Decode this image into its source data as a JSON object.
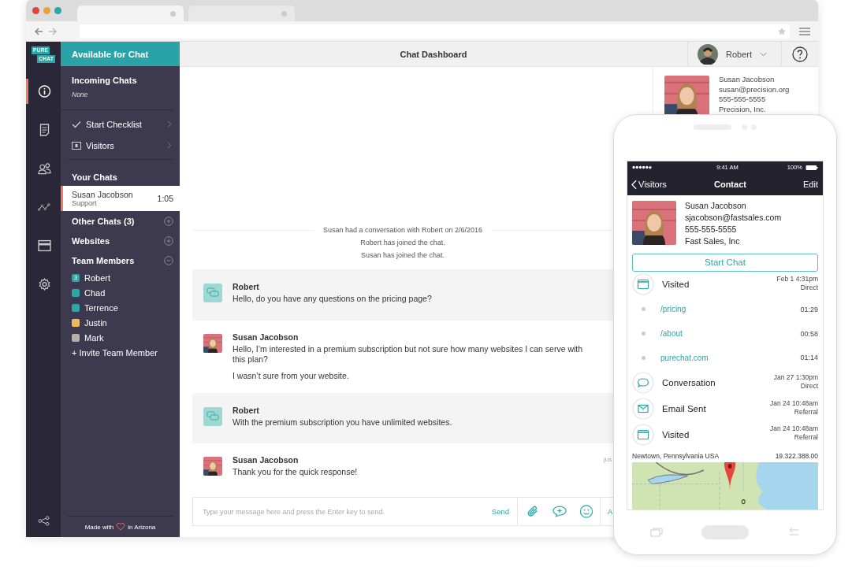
{
  "app": {
    "logo": [
      "PURE",
      "CHAT"
    ],
    "status": "Available for Chat",
    "rail": [
      {
        "kind": "info",
        "selected": true
      },
      {
        "kind": "document",
        "selected": false
      },
      {
        "kind": "people",
        "selected": false
      },
      {
        "kind": "analytics",
        "selected": false
      },
      {
        "kind": "billing",
        "selected": false
      },
      {
        "kind": "settings",
        "selected": false
      }
    ],
    "incoming": {
      "title": "Incoming Chats",
      "note": "None"
    },
    "links": [
      {
        "kind": "check",
        "label": "Start Checklist"
      },
      {
        "kind": "visitors",
        "label": "Visitors"
      }
    ],
    "your_chats": {
      "title": "Your Chats",
      "items": [
        {
          "name": "Susan Jacobson",
          "department": "Support",
          "time": "1:05",
          "selected": true
        }
      ]
    },
    "sections": [
      {
        "title": "Other Chats (3)",
        "expanded": false
      },
      {
        "title": "Websites",
        "expanded": false
      },
      {
        "title": "Team Members",
        "expanded": true,
        "members": [
          {
            "name": "Robert",
            "badge": "3",
            "color": "#2ba7a8"
          },
          {
            "name": "Chad",
            "color": "#2ba7a8"
          },
          {
            "name": "Terrence",
            "color": "#2ba7a8"
          },
          {
            "name": "Justin",
            "color": "#f2b95c"
          },
          {
            "name": "Mark",
            "color": "#b4b0a6"
          }
        ],
        "invite": "+ Invite Team Member"
      }
    ],
    "footer": {
      "before": "Made with",
      "after": "in Arizona"
    }
  },
  "header": {
    "title": "Chat Dashboard",
    "user": "Robert"
  },
  "chat": {
    "events": [
      "Susan had a conversation with Robert on 2/6/2016",
      "Robert has joined the chat.",
      "Susan has joined the chat."
    ],
    "messages": [
      {
        "kind": "operator",
        "sender": "Robert",
        "lines": [
          "Hello, do you have any questions on the pricing page?"
        ]
      },
      {
        "kind": "visitor",
        "sender": "Susan Jacobson",
        "lines": [
          "Hello, I’m interested in a premium subscription but not sure how many websites I can serve with this plan?",
          "I wasn’t sure from your website."
        ]
      },
      {
        "kind": "operator",
        "sender": "Robert",
        "lines": [
          "With the premium subscription you have unlimited websites."
        ]
      },
      {
        "kind": "visitor",
        "sender": "Susan Jacobson",
        "lines": [
          "Thank you for the quick response!"
        ],
        "time": "jus"
      }
    ],
    "composer": {
      "placeholder": "Type your message here and press the Enter key to send.",
      "send": "Send",
      "cut_label": "A"
    }
  },
  "contact": {
    "name": "Susan Jacobson",
    "email": "susan@precision.org",
    "phone": "555-555-5555",
    "company": "Precision, Inc."
  },
  "phone": {
    "status": {
      "time": "9:41 AM",
      "battery": "100%"
    },
    "nav": {
      "back": "Visitors",
      "title": "Contact",
      "action": "Edit"
    },
    "contact": {
      "name": "Susan Jacobson",
      "email": "sjacobson@fastsales.com",
      "phone": "555-555-5555",
      "company": "Fast Sales, Inc"
    },
    "start_button": "Start Chat",
    "timeline": [
      {
        "kind": "visit",
        "title": "Visited",
        "date": "Feb 1 4:31pm",
        "source": "Direct"
      },
      {
        "kind": "page",
        "title": "/pricing",
        "duration": "01:29"
      },
      {
        "kind": "page",
        "title": "/about",
        "duration": "00:58"
      },
      {
        "kind": "page",
        "title": "purechat.com",
        "duration": "01:14"
      },
      {
        "kind": "conversation",
        "title": "Conversation",
        "date": "Jan 27 1:30pm",
        "source": "Direct"
      },
      {
        "kind": "email",
        "title": "Email Sent",
        "date": "Jan 24 10:48am",
        "source": "Referral"
      },
      {
        "kind": "visit",
        "title": "Visited",
        "date": "Jan 24 10:48am",
        "source": "Referral"
      }
    ],
    "location": "Newtown, Pennsylvania USA",
    "ip": "19.322.388.00"
  }
}
